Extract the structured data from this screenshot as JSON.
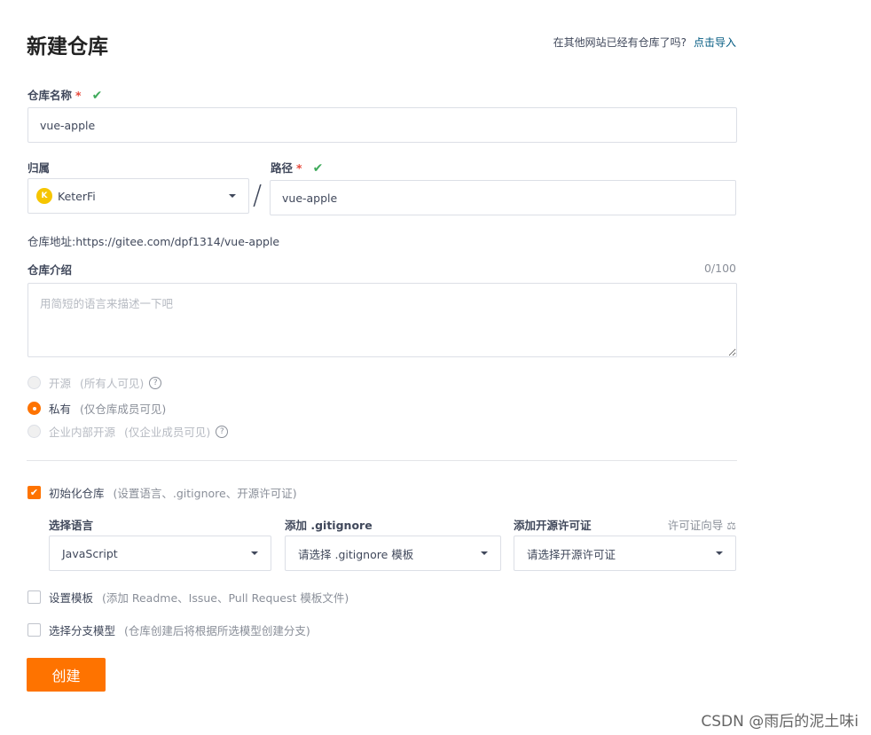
{
  "header": {
    "title": "新建仓库",
    "import_prompt": "在其他网站已经有仓库了吗?",
    "import_link": "点击导入"
  },
  "repo_name": {
    "label": "仓库名称",
    "required": "*",
    "check": "✔",
    "value": "vue-apple"
  },
  "owner": {
    "label": "归属",
    "avatar_letter": "K",
    "value": "KeterFi"
  },
  "path": {
    "separator": "/",
    "label": "路径",
    "required": "*",
    "check": "✔",
    "value": "vue-apple"
  },
  "address": {
    "label": "仓库地址:",
    "url": "https://gitee.com/dpf1314/vue-apple"
  },
  "description": {
    "label": "仓库介绍",
    "counter": "0/100",
    "placeholder": "用简短的语言来描述一下吧"
  },
  "visibility": {
    "options": [
      {
        "label": "开源",
        "hint": "(所有人可见)",
        "selected": false,
        "disabled": true,
        "help": true
      },
      {
        "label": "私有",
        "hint": "(仅仓库成员可见)",
        "selected": true,
        "disabled": false,
        "help": false
      },
      {
        "label": "企业内部开源",
        "hint": "(仅企业成员可见)",
        "selected": false,
        "disabled": true,
        "help": true
      }
    ],
    "help_glyph": "?"
  },
  "init": {
    "checkbox_label": "初始化仓库",
    "checkbox_hint": "(设置语言、.gitignore、开源许可证)",
    "checked": true,
    "check_glyph": "✔",
    "language": {
      "label": "选择语言",
      "value": "JavaScript"
    },
    "gitignore": {
      "label": "添加 .gitignore",
      "value": "请选择 .gitignore 模板"
    },
    "license": {
      "label": "添加开源许可证",
      "value": "请选择开源许可证",
      "guide_link": "许可证向导",
      "guide_icon": "⚖"
    }
  },
  "template": {
    "label": "设置模板",
    "hint": "(添加 Readme、Issue、Pull Request 模板文件)",
    "checked": false
  },
  "branch_model": {
    "label": "选择分支模型",
    "hint": "(仓库创建后将根据所选模型创建分支)",
    "checked": false
  },
  "create_button": "创建",
  "watermark": "CSDN @雨后的泥土味i",
  "colors": {
    "accent": "#fe7300",
    "check_green": "#3faa5b",
    "link": "#005980",
    "required": "#e84a3c"
  }
}
